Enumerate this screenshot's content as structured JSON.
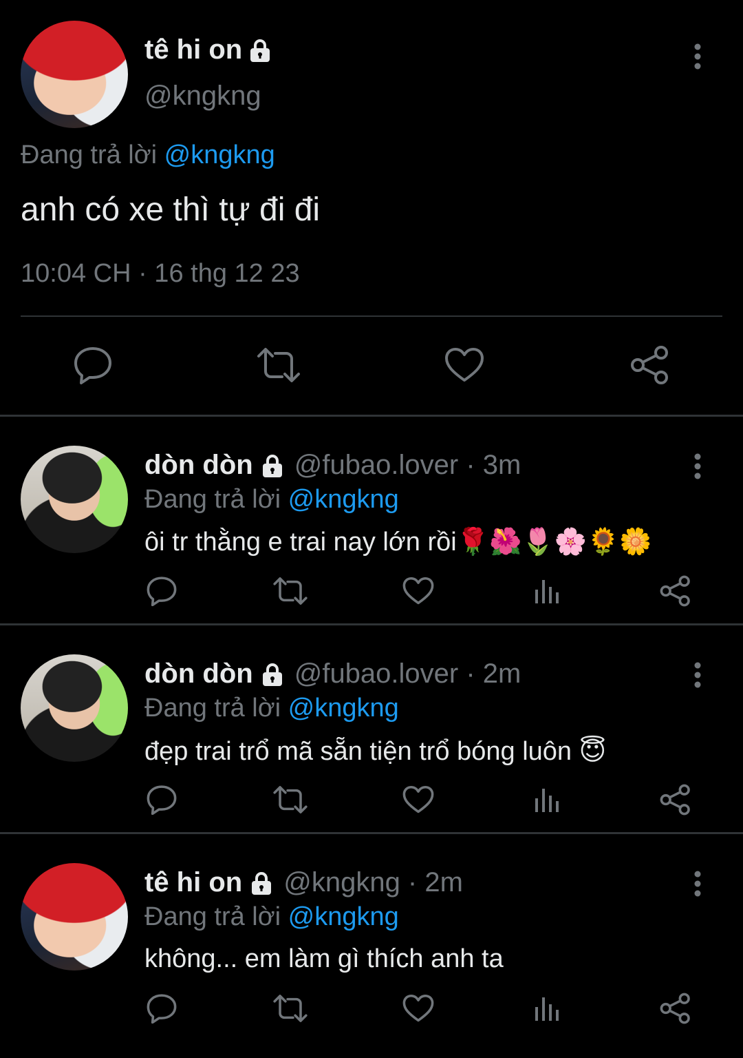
{
  "main_tweet": {
    "display_name": "tê hi on",
    "handle": "@kngkng",
    "replying_prefix": "Đang trả lời",
    "replying_to": "@kngkng",
    "text": "anh có xe thì tự đi đi",
    "timestamp": "10:04 CH · 16 thg 12 23",
    "icons": [
      "lock-icon",
      "more-icon",
      "reply-icon",
      "retweet-icon",
      "like-icon",
      "share-icon"
    ]
  },
  "replies": [
    {
      "display_name": "dòn dòn",
      "meta": "@fubao.lover · 3m",
      "replying_prefix": "Đang trả lời",
      "replying_to": "@kngkng",
      "text": "ôi tr thằng e trai nay lớn rồi🌹🌺🌷🌸🌻🌼"
    },
    {
      "display_name": "dòn dòn",
      "meta": "@fubao.lover · 2m",
      "replying_prefix": "Đang trả lời",
      "replying_to": "@kngkng",
      "text": "đẹp trai trổ mã sẵn tiện trổ bóng luôn 😇"
    },
    {
      "display_name": "tê hi on",
      "meta": "@kngkng · 2m",
      "replying_prefix": "Đang trả lời",
      "replying_to": "@kngkng",
      "text": "không... em làm gì thích anh ta"
    }
  ],
  "colors": {
    "background": "#000000",
    "text": "#e7e9ea",
    "muted": "#71767b",
    "accent": "#1d9bf0",
    "divider": "#2f3336"
  }
}
